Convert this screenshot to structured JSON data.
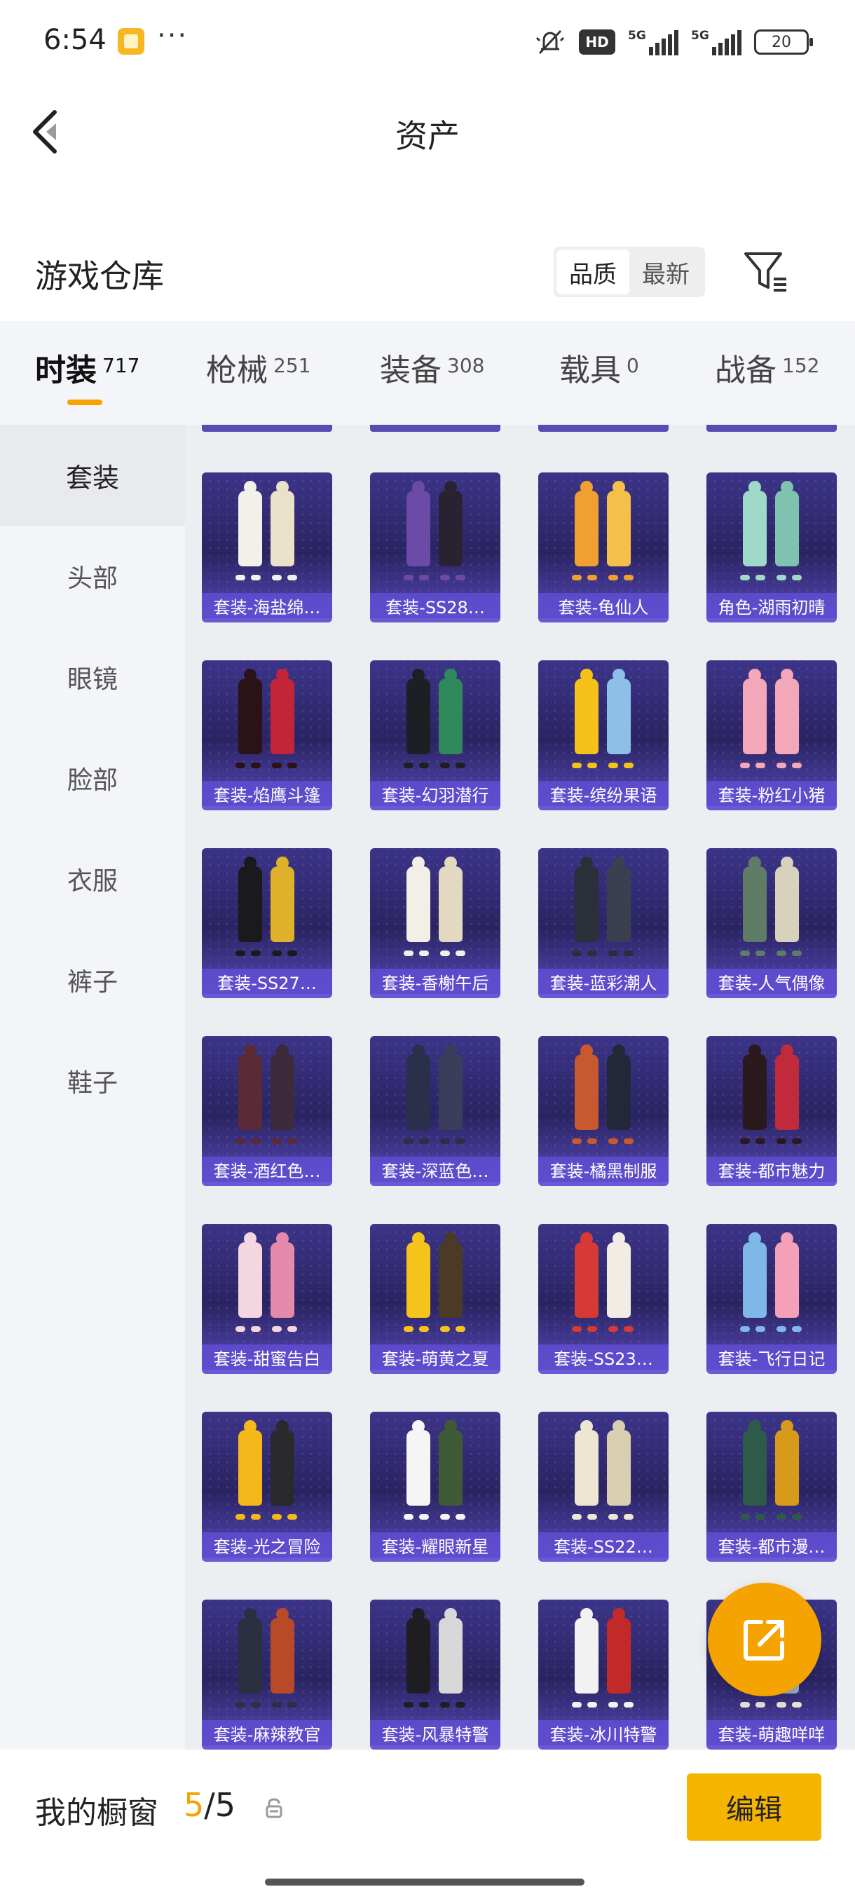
{
  "status": {
    "time": "6:54",
    "dots": "···",
    "hd": "HD",
    "net1": "5G",
    "net2": "5G",
    "battery": "20"
  },
  "header": {
    "title": "资产"
  },
  "warehouse": {
    "title": "游戏仓库",
    "sort_options": [
      "品质",
      "最新"
    ],
    "sort_active": 0
  },
  "tabs": [
    {
      "label": "时装",
      "count": "717"
    },
    {
      "label": "枪械",
      "count": "251"
    },
    {
      "label": "装备",
      "count": "308"
    },
    {
      "label": "载具",
      "count": "0"
    },
    {
      "label": "战备",
      "count": "152"
    }
  ],
  "sidebar": {
    "items": [
      {
        "label": "套装"
      },
      {
        "label": "头部"
      },
      {
        "label": "眼镜"
      },
      {
        "label": "脸部"
      },
      {
        "label": "衣服"
      },
      {
        "label": "裤子"
      },
      {
        "label": "鞋子"
      }
    ]
  },
  "items": [
    {
      "label": "套装-海盐绵…",
      "c1": "#f2f0ea",
      "c2": "#e9e2c8"
    },
    {
      "label": "套装-SS28…",
      "c1": "#6b4aa8",
      "c2": "#2a2230"
    },
    {
      "label": "套装-龟仙人",
      "c1": "#f0a030",
      "c2": "#f4c04a"
    },
    {
      "label": "角色-湖雨初晴",
      "c1": "#9fd9c9",
      "c2": "#7fc2b0"
    },
    {
      "label": "套装-焰鹰斗篷",
      "c1": "#2a1216",
      "c2": "#c2243a"
    },
    {
      "label": "套装-幻羽潜行",
      "c1": "#1e1f24",
      "c2": "#2e8a5a"
    },
    {
      "label": "套装-缤纷果语",
      "c1": "#f5c21c",
      "c2": "#8cc0e8"
    },
    {
      "label": "套装-粉红小猪",
      "c1": "#f3a7b9",
      "c2": "#f3a7b9"
    },
    {
      "label": "套装-SS27…",
      "c1": "#1a1a1c",
      "c2": "#e0b12a"
    },
    {
      "label": "套装-香榭午后",
      "c1": "#f2efe6",
      "c2": "#e3d8c0"
    },
    {
      "label": "套装-蓝彩潮人",
      "c1": "#2a2f3a",
      "c2": "#3a4050"
    },
    {
      "label": "套装-人气偶像",
      "c1": "#5f7c66",
      "c2": "#d8d2bc"
    },
    {
      "label": "套装-酒红色…",
      "c1": "#5a2a36",
      "c2": "#3d2a3a"
    },
    {
      "label": "套装-深蓝色…",
      "c1": "#2a2f4a",
      "c2": "#3a3e5a"
    },
    {
      "label": "套装-橘黑制服",
      "c1": "#c8582e",
      "c2": "#22283a"
    },
    {
      "label": "套装-都市魅力",
      "c1": "#2a1a1e",
      "c2": "#c02a3a"
    },
    {
      "label": "套装-甜蜜告白",
      "c1": "#f3d6df",
      "c2": "#e58aaa"
    },
    {
      "label": "套装-萌黄之夏",
      "c1": "#f5c41a",
      "c2": "#4a3a26"
    },
    {
      "label": "套装-SS23…",
      "c1": "#d63a34",
      "c2": "#f2ede4"
    },
    {
      "label": "套装-飞行日记",
      "c1": "#7fb8e8",
      "c2": "#f3a0b8"
    },
    {
      "label": "套装-光之冒险",
      "c1": "#f5b81a",
      "c2": "#2a2a2e"
    },
    {
      "label": "套装-耀眼新星",
      "c1": "#f5f5f5",
      "c2": "#3e5a36"
    },
    {
      "label": "套装-SS22…",
      "c1": "#ece6d2",
      "c2": "#d8cfb2"
    },
    {
      "label": "套装-都市漫…",
      "c1": "#2e5a4a",
      "c2": "#d89a1a"
    },
    {
      "label": "套装-麻辣教官",
      "c1": "#2a3040",
      "c2": "#b84a2a"
    },
    {
      "label": "套装-风暴特警",
      "c1": "#1e1e22",
      "c2": "#d8d8d8"
    },
    {
      "label": "套装-冰川特警",
      "c1": "#f2f2f2",
      "c2": "#c22a2a"
    },
    {
      "label": "套装-萌趣咩咩",
      "c1": "#e8e2d8",
      "c2": "#9ab0c8"
    }
  ],
  "showcase": {
    "label": "我的橱窗",
    "current": "5",
    "slash": "/",
    "max": "5"
  },
  "actions": {
    "edit": "编辑"
  },
  "colors": {
    "accent": "#f5a300",
    "card_bg": "#2a2462",
    "card_label": "#604ed2"
  }
}
